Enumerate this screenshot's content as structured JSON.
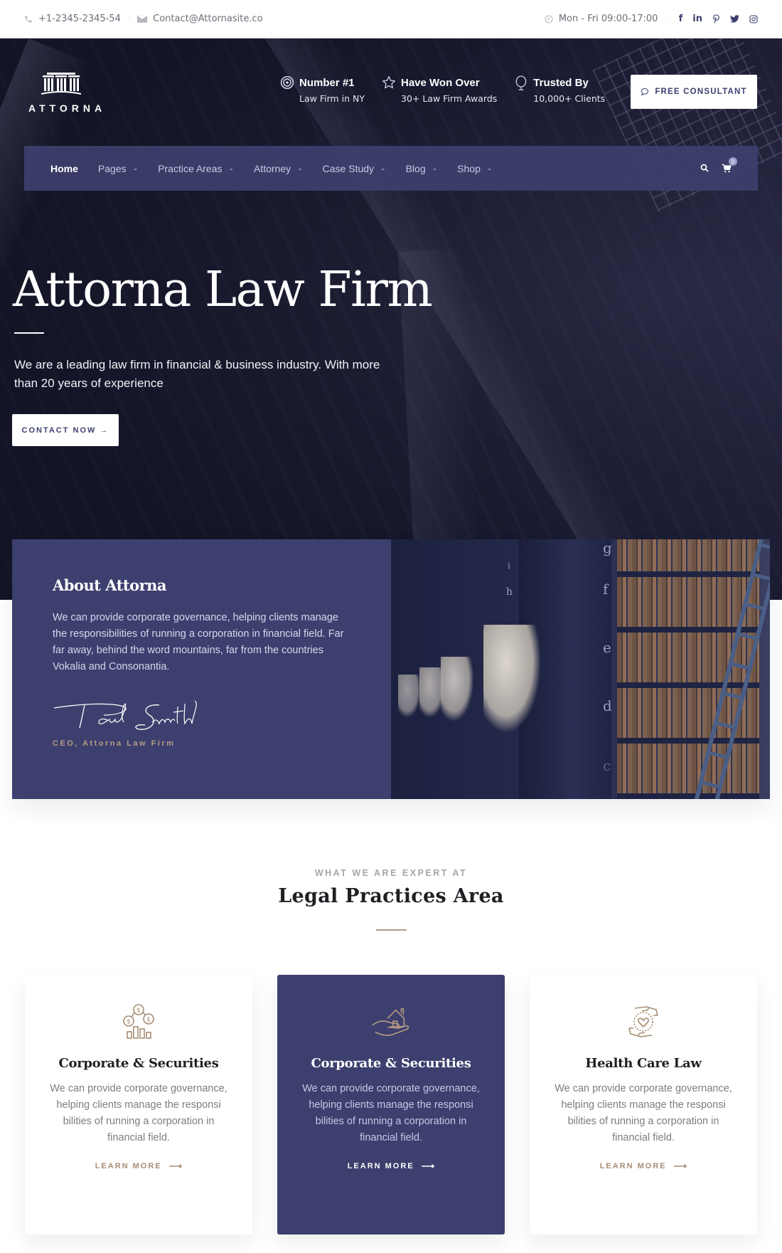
{
  "topbar": {
    "phone": "+1-2345-2345-54",
    "email": "Contact@Attornasite.co",
    "hours": "Mon - Fri 09:00-17:00",
    "socials": [
      "facebook-icon",
      "linkedin-icon",
      "pinterest-icon",
      "twitter-icon",
      "instagram-icon"
    ]
  },
  "brand": {
    "name": "ATTORNA"
  },
  "features": [
    {
      "icon": "target-icon",
      "title": "Number #1",
      "subtitle": "Law Firm in NY"
    },
    {
      "icon": "star-icon",
      "title": "Have Won Over",
      "subtitle": "30+ Law Firm Awards"
    },
    {
      "icon": "award-icon",
      "title": "Trusted By",
      "subtitle": "10,000+ Clients"
    }
  ],
  "header": {
    "consult_label": "FREE CONSULTANT"
  },
  "nav": {
    "items": [
      {
        "label": "Home",
        "active": true,
        "dropdown": false
      },
      {
        "label": "Pages",
        "dropdown": true
      },
      {
        "label": "Practice Areas",
        "dropdown": true
      },
      {
        "label": "Attorney",
        "dropdown": true
      },
      {
        "label": "Case Study",
        "dropdown": true
      },
      {
        "label": "Blog",
        "dropdown": true
      },
      {
        "label": "Shop",
        "dropdown": true
      }
    ],
    "cart_count": "0"
  },
  "hero": {
    "title": "Attorna Law Firm",
    "text": "We are a leading law firm in financial & business industry. With more than 20 years of experience",
    "cta_label": "CONTACT NOW →"
  },
  "about": {
    "title": "About Attorna",
    "text": "We can provide corporate governance, helping clients manage the responsibilities of running a corporation in financial field. Far far away, behind the word mountains, far from the countries Vokalia and Consonantia.",
    "signature": "Paul Smith",
    "role": "CEO, Attorna Law Firm",
    "image_letters": [
      "g",
      "f",
      "e",
      "d",
      "c",
      "h",
      "i"
    ]
  },
  "practices": {
    "kicker": "WHAT WE ARE EXPERT AT",
    "title": "Legal Practices Area",
    "cards": [
      {
        "icon": "coins-chart-icon",
        "title": "Corporate & Securities",
        "text": "We can provide corporate governance, helping clients manage the responsi bilities of running a corporation in financial field.",
        "link": "LEARN MORE",
        "highlighted": false
      },
      {
        "icon": "hand-house-icon",
        "title": "Corporate & Securities",
        "text": "We can provide corporate governance, helping clients manage the responsi bilities of running a corporation in financial field.",
        "link": "LEARN MORE",
        "highlighted": true
      },
      {
        "icon": "hands-heart-icon",
        "title": "Health Care Law",
        "text": "We can provide corporate governance, helping clients manage the responsi bilities of running a corporation in financial field.",
        "link": "LEARN MORE",
        "highlighted": false
      }
    ]
  },
  "colors": {
    "primary": "#3d3f6e",
    "accent": "#b59a83",
    "hero_dark": "#1a1b2e"
  }
}
